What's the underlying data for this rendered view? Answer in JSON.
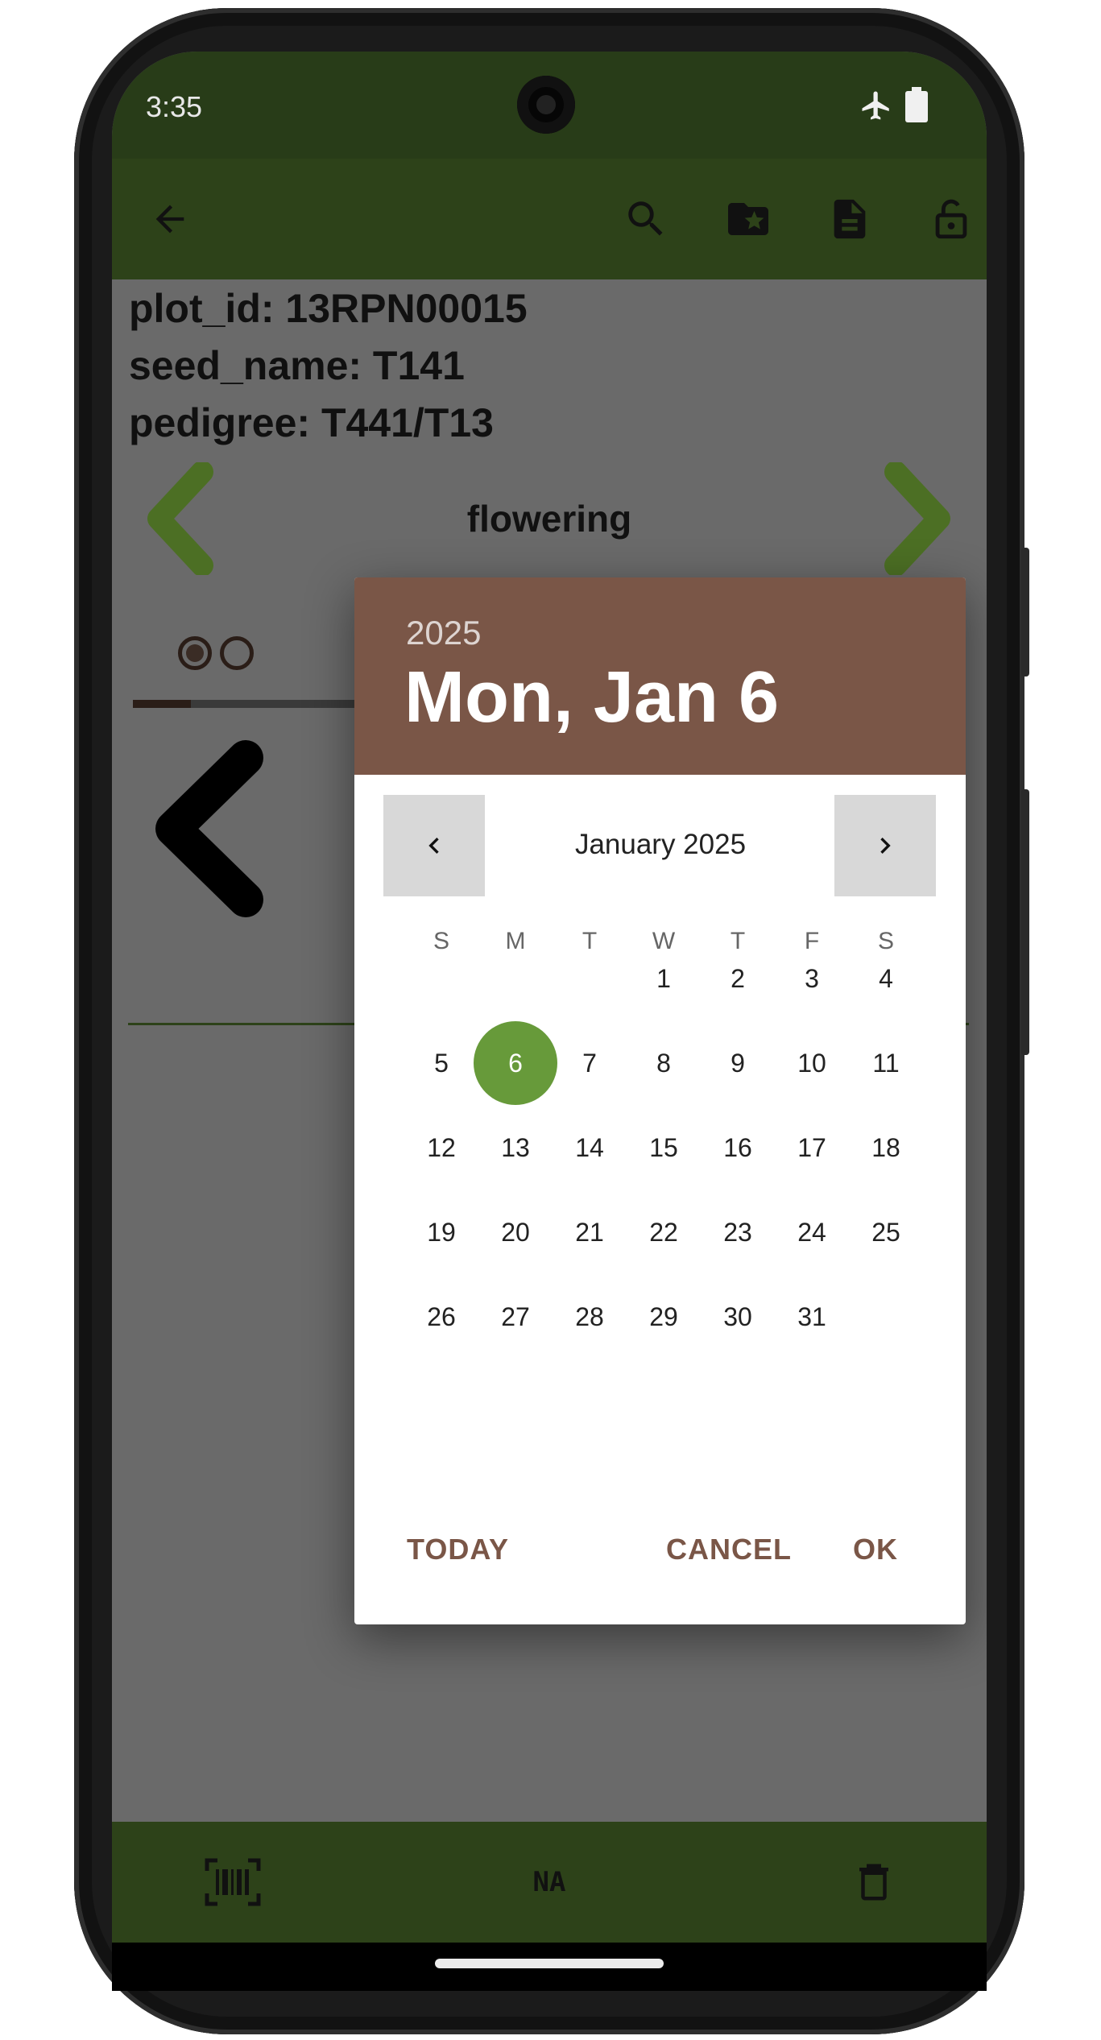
{
  "status_bar": {
    "time": "3:35"
  },
  "toolbar": {
    "back_icon": "arrow-left-icon",
    "search_icon": "search-icon",
    "favorites_icon": "folder-star-icon",
    "summary_icon": "document-icon",
    "lock_icon": "lock-open-icon"
  },
  "plot_info": {
    "line1": "plot_id: 13RPN00015",
    "line2": "seed_name: T141",
    "line3": "pedigree: T441/T13"
  },
  "trait": {
    "name": "flowering",
    "progress_fraction": 0.07
  },
  "bottom_bar": {
    "na_label": "NA"
  },
  "date_picker": {
    "year": "2025",
    "header_date": "Mon, Jan 6",
    "month_label": "January 2025",
    "weekdays": [
      "S",
      "M",
      "T",
      "W",
      "T",
      "F",
      "S"
    ],
    "first_weekday_index": 3,
    "days": [
      "1",
      "2",
      "3",
      "4",
      "5",
      "6",
      "7",
      "8",
      "9",
      "10",
      "11",
      "12",
      "13",
      "14",
      "15",
      "16",
      "17",
      "18",
      "19",
      "20",
      "21",
      "22",
      "23",
      "24",
      "25",
      "26",
      "27",
      "28",
      "29",
      "30",
      "31"
    ],
    "selected_day": "6",
    "accent_color": "#679a3a",
    "header_color": "#7a5647",
    "buttons": {
      "today": "TODAY",
      "cancel": "CANCEL",
      "ok": "OK"
    }
  }
}
